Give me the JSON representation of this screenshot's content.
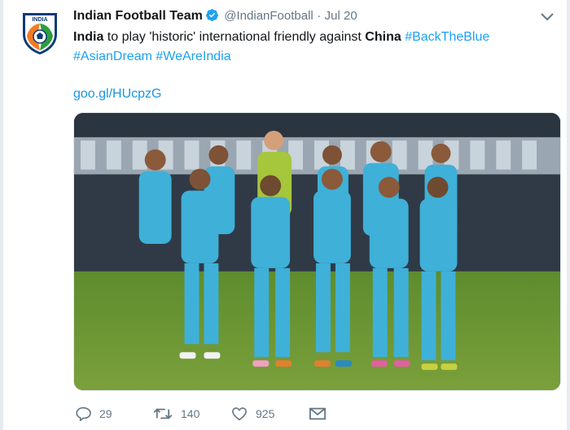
{
  "tweet": {
    "display_name": "Indian Football Team",
    "handle": "@IndianFootball",
    "separator": "·",
    "date": "Jul 20",
    "text": {
      "w1": "India",
      "w2": " to play 'historic' international friendly against ",
      "w3": "China",
      "hashtag1": "#BackTheBlue",
      "hashtag2": "#AsianDream",
      "hashtag3": "#WeAreIndia"
    },
    "link": "goo.gl/HUcpzG",
    "avatar_text": "INDIA",
    "counts": {
      "replies": "29",
      "retweets": "140",
      "likes": "925"
    }
  },
  "icons": {
    "verified": "verified-badge-icon",
    "caret": "chevron-down-icon",
    "reply": "reply-icon",
    "retweet": "retweet-icon",
    "like": "heart-icon",
    "message": "envelope-icon"
  },
  "colors": {
    "accent": "#1da1f2",
    "muted": "#657786",
    "jersey": "#3fb0d8"
  }
}
